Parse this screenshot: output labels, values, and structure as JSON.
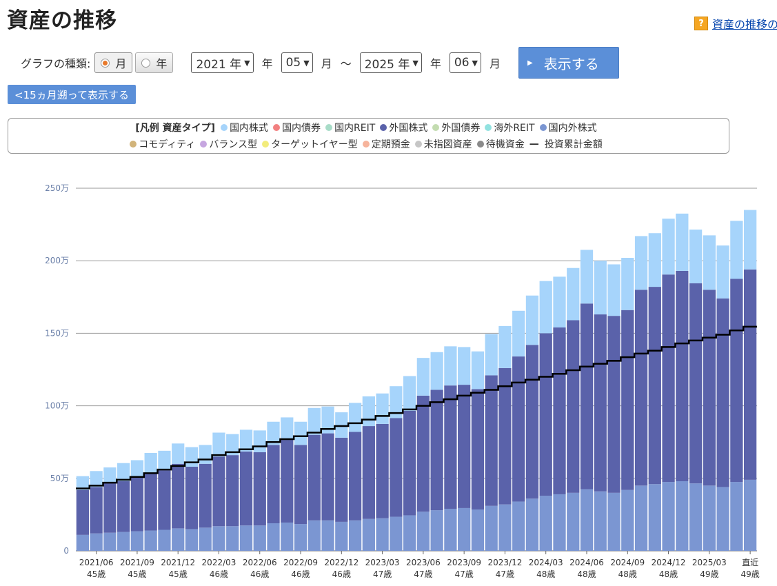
{
  "page_title": "資産の推移",
  "help_link": "資産の推移の",
  "controls": {
    "graph_type_label": "グラフの種類:",
    "type_month": "月",
    "type_year": "年",
    "start_year": "2021 年",
    "year_unit": "年",
    "start_month": "05",
    "month_unit": "月",
    "tilde": "～",
    "end_year": "2025 年",
    "end_month": "06",
    "show_button": "表示する",
    "back_button": "<15ヵ月遡って表示する"
  },
  "legend": {
    "title": "[凡例 資産タイプ]",
    "items": [
      {
        "label": "国内株式",
        "color": "#a6d4fb"
      },
      {
        "label": "国内債券",
        "color": "#f28080"
      },
      {
        "label": "国内REIT",
        "color": "#a8dcc8"
      },
      {
        "label": "外国株式",
        "color": "#5a62aa"
      },
      {
        "label": "外国債券",
        "color": "#c3dcb0"
      },
      {
        "label": "海外REIT",
        "color": "#92e2e0"
      },
      {
        "label": "国内外株式",
        "color": "#7b96d2"
      },
      {
        "label": "コモディティ",
        "color": "#d2b47a"
      },
      {
        "label": "バランス型",
        "color": "#c6a6e0"
      },
      {
        "label": "ターゲットイヤー型",
        "color": "#f2ec7c"
      },
      {
        "label": "定期預金",
        "color": "#f6b49c"
      },
      {
        "label": "未指図資産",
        "color": "#c6c6c6"
      },
      {
        "label": "待機資金",
        "color": "#8a8a8a"
      },
      {
        "label": "投資累計金額",
        "color": "#000000"
      }
    ]
  },
  "chart_data": {
    "type": "bar",
    "stacked": true,
    "y_axis": {
      "min": 0,
      "max": 250,
      "ticks": [
        0,
        50,
        100,
        150,
        200,
        250
      ],
      "tick_labels": [
        "0",
        "50万",
        "100万",
        "150万",
        "200万",
        "250万"
      ]
    },
    "x_tick_labels": [
      {
        "index": 1,
        "date": "2021/06",
        "age": "45歳"
      },
      {
        "index": 4,
        "date": "2021/09",
        "age": "45歳"
      },
      {
        "index": 7,
        "date": "2021/12",
        "age": "45歳"
      },
      {
        "index": 10,
        "date": "2022/03",
        "age": "46歳"
      },
      {
        "index": 13,
        "date": "2022/06",
        "age": "46歳"
      },
      {
        "index": 16,
        "date": "2022/09",
        "age": "46歳"
      },
      {
        "index": 19,
        "date": "2022/12",
        "age": "46歳"
      },
      {
        "index": 22,
        "date": "2023/03",
        "age": "47歳"
      },
      {
        "index": 25,
        "date": "2023/06",
        "age": "47歳"
      },
      {
        "index": 28,
        "date": "2023/09",
        "age": "47歳"
      },
      {
        "index": 31,
        "date": "2023/12",
        "age": "47歳"
      },
      {
        "index": 34,
        "date": "2024/03",
        "age": "48歳"
      },
      {
        "index": 37,
        "date": "2024/06",
        "age": "48歳"
      },
      {
        "index": 40,
        "date": "2024/09",
        "age": "48歳"
      },
      {
        "index": 43,
        "date": "2024/12",
        "age": "48歳"
      },
      {
        "index": 46,
        "date": "2025/03",
        "age": "49歳"
      },
      {
        "index": 49,
        "date": "直近",
        "age": "49歳"
      }
    ],
    "categories": [
      "2021/05",
      "2021/06",
      "2021/07",
      "2021/08",
      "2021/09",
      "2021/10",
      "2021/11",
      "2021/12",
      "2022/01",
      "2022/02",
      "2022/03",
      "2022/04",
      "2022/05",
      "2022/06",
      "2022/07",
      "2022/08",
      "2022/09",
      "2022/10",
      "2022/11",
      "2022/12",
      "2023/01",
      "2023/02",
      "2023/03",
      "2023/04",
      "2023/05",
      "2023/06",
      "2023/07",
      "2023/08",
      "2023/09",
      "2023/10",
      "2023/11",
      "2023/12",
      "2024/01",
      "2024/02",
      "2024/03",
      "2024/04",
      "2024/05",
      "2024/06",
      "2024/07",
      "2024/08",
      "2024/09",
      "2024/10",
      "2024/11",
      "2024/12",
      "2025/01",
      "2025/02",
      "2025/03",
      "2025/04",
      "2025/05",
      "直近"
    ],
    "series": [
      {
        "name": "国内外株式",
        "color": "#7b96d2",
        "values": [
          11,
          12,
          12.5,
          13,
          13.5,
          14,
          14.5,
          15.5,
          15,
          16,
          17,
          17,
          17.5,
          17.5,
          19,
          19.5,
          18.5,
          21,
          21,
          20,
          21,
          22,
          22.5,
          23.5,
          24.5,
          27,
          28,
          29,
          29.5,
          28.5,
          31,
          32,
          34,
          36,
          38,
          39,
          40,
          42.5,
          41,
          40,
          42,
          45,
          46,
          47.5,
          48,
          46.5,
          45,
          44,
          47.5,
          49
        ]
      },
      {
        "name": "外国株式",
        "color": "#5a62aa",
        "values": [
          31,
          32,
          34.5,
          35,
          37,
          39.5,
          41,
          44.5,
          43,
          44,
          48,
          49,
          51,
          50.5,
          54,
          57,
          54.5,
          59,
          60,
          58,
          61,
          64,
          65,
          68,
          72,
          80,
          83,
          85,
          85,
          83,
          90,
          94,
          100,
          106,
          112,
          115,
          119,
          128,
          122,
          122,
          124,
          135,
          136,
          143,
          145,
          138,
          135,
          130,
          140,
          145
        ]
      },
      {
        "name": "国内株式",
        "color": "#a6d4fb",
        "values": [
          9.5,
          11,
          10.5,
          12.5,
          12,
          14,
          13.5,
          14,
          13.5,
          13,
          16.5,
          14.5,
          15,
          15,
          16,
          15.5,
          16,
          18.5,
          18.5,
          17.5,
          20,
          20.5,
          21,
          22,
          24,
          26,
          26,
          27,
          26,
          26,
          28.5,
          29,
          31.5,
          34,
          36,
          35,
          36,
          37,
          37,
          35.5,
          36,
          37,
          37,
          38.5,
          39.5,
          37,
          37.5,
          36.5,
          40,
          41
        ]
      }
    ],
    "line": {
      "name": "投資累計金額",
      "color": "#000000",
      "values": [
        43,
        45,
        47,
        49,
        51,
        53.5,
        56,
        58.5,
        61,
        63,
        66,
        68,
        70,
        72,
        75,
        77,
        79,
        81.5,
        84,
        86,
        88,
        90.5,
        93,
        95,
        97.5,
        100,
        102.5,
        104.5,
        107,
        109,
        111,
        113.5,
        116,
        118,
        120,
        122,
        124.5,
        127,
        129,
        131,
        133.5,
        136,
        138,
        140.5,
        143,
        145,
        147,
        149,
        152,
        154.5
      ]
    }
  }
}
